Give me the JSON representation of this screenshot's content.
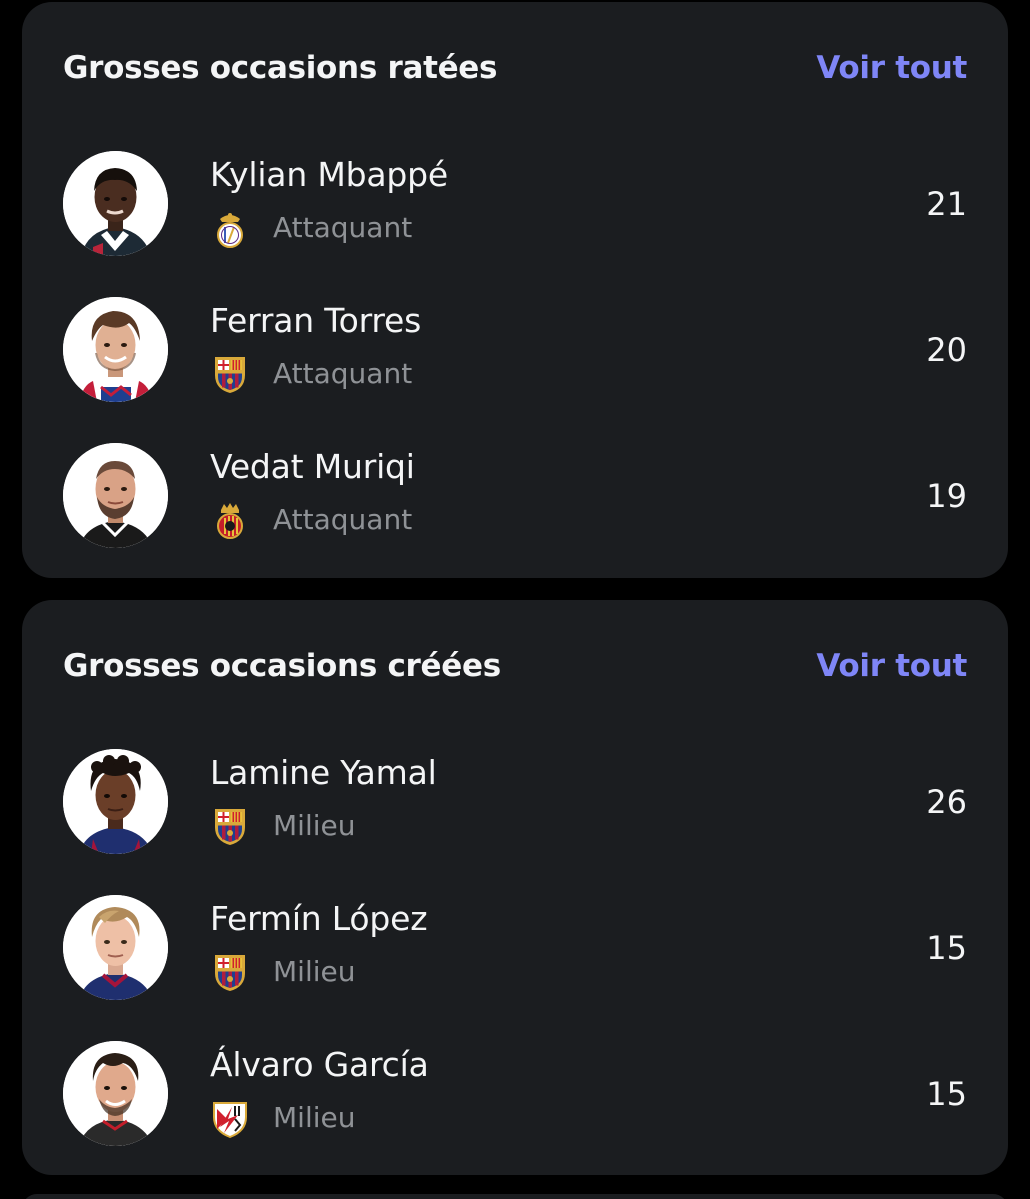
{
  "sections": [
    {
      "title": "Grosses occasions ratées",
      "see_all": "Voir tout",
      "players": [
        {
          "name": "Kylian Mbappé",
          "position": "Attaquant",
          "value": "21",
          "club_icon": "real-madrid-crest-icon"
        },
        {
          "name": "Ferran Torres",
          "position": "Attaquant",
          "value": "20",
          "club_icon": "fc-barcelona-crest-icon"
        },
        {
          "name": "Vedat Muriqi",
          "position": "Attaquant",
          "value": "19",
          "club_icon": "rcd-mallorca-crest-icon"
        }
      ]
    },
    {
      "title": "Grosses occasions créées",
      "see_all": "Voir tout",
      "players": [
        {
          "name": "Lamine Yamal",
          "position": "Milieu",
          "value": "26",
          "club_icon": "fc-barcelona-crest-icon"
        },
        {
          "name": "Fermín López",
          "position": "Milieu",
          "value": "15",
          "club_icon": "fc-barcelona-crest-icon"
        },
        {
          "name": "Álvaro García",
          "position": "Milieu",
          "value": "15",
          "club_icon": "rayo-vallecano-crest-icon"
        }
      ]
    }
  ],
  "colors": {
    "background": "#000000",
    "card": "#1b1d20",
    "accent": "#7f86f7",
    "text_primary": "#f4f5f6",
    "text_secondary": "#8f9296"
  }
}
